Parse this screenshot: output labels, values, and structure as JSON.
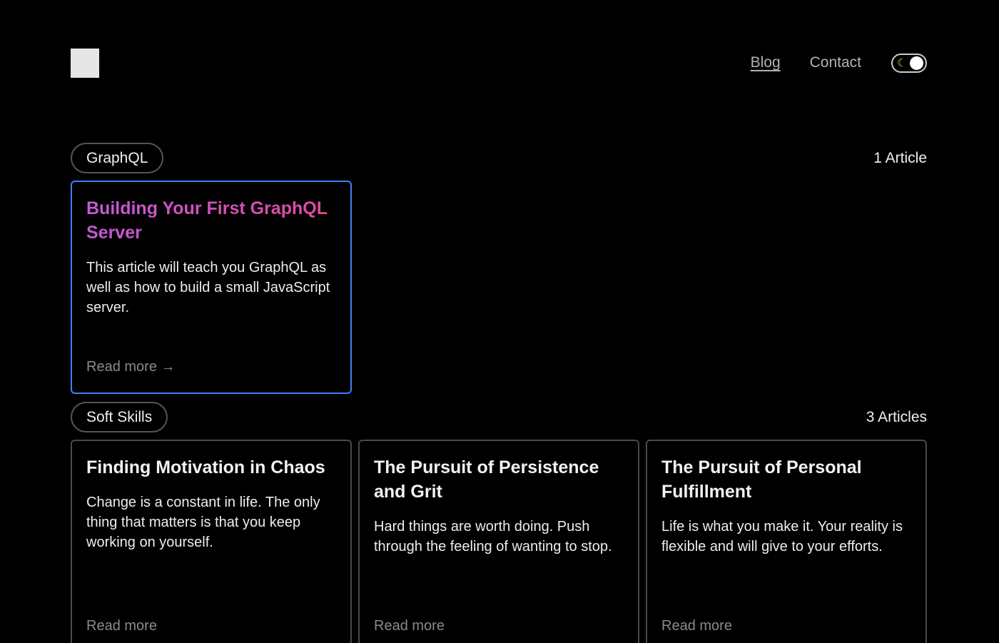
{
  "nav": {
    "links": [
      "Blog",
      "Contact"
    ],
    "theme_toggle_icon": "moon-icon"
  },
  "sections": [
    {
      "tag": "GraphQL",
      "count": "1 Article",
      "articles": [
        {
          "title": "Building Your First GraphQL Server",
          "description": "This article will teach you GraphQL as well as how to build a small JavaScript server.",
          "read_more": "Read more →"
        }
      ]
    },
    {
      "tag": "Soft Skills",
      "count": "3 Articles",
      "articles": [
        {
          "title": "Finding Motivation in Chaos",
          "description": "Change is a constant in life. The only thing that matters is that you keep working on yourself.",
          "read_more": "Read more"
        },
        {
          "title": "The Pursuit of Persistence and Grit",
          "description": "Hard things are worth doing. Push through the feeling of wanting to stop.",
          "read_more": "Read more"
        },
        {
          "title": "The Pursuit of Personal Fulfillment",
          "description": "Life is what you make it. Your reality is flexible and will give to your efforts.",
          "read_more": "Read more"
        }
      ]
    }
  ],
  "colors": {
    "background": "#000000",
    "highlight_border": "#3b82f6",
    "title_gradient_start": "#c25ad8",
    "title_gradient_end": "#e04a9a",
    "toggle_moon": "#f5c542"
  }
}
